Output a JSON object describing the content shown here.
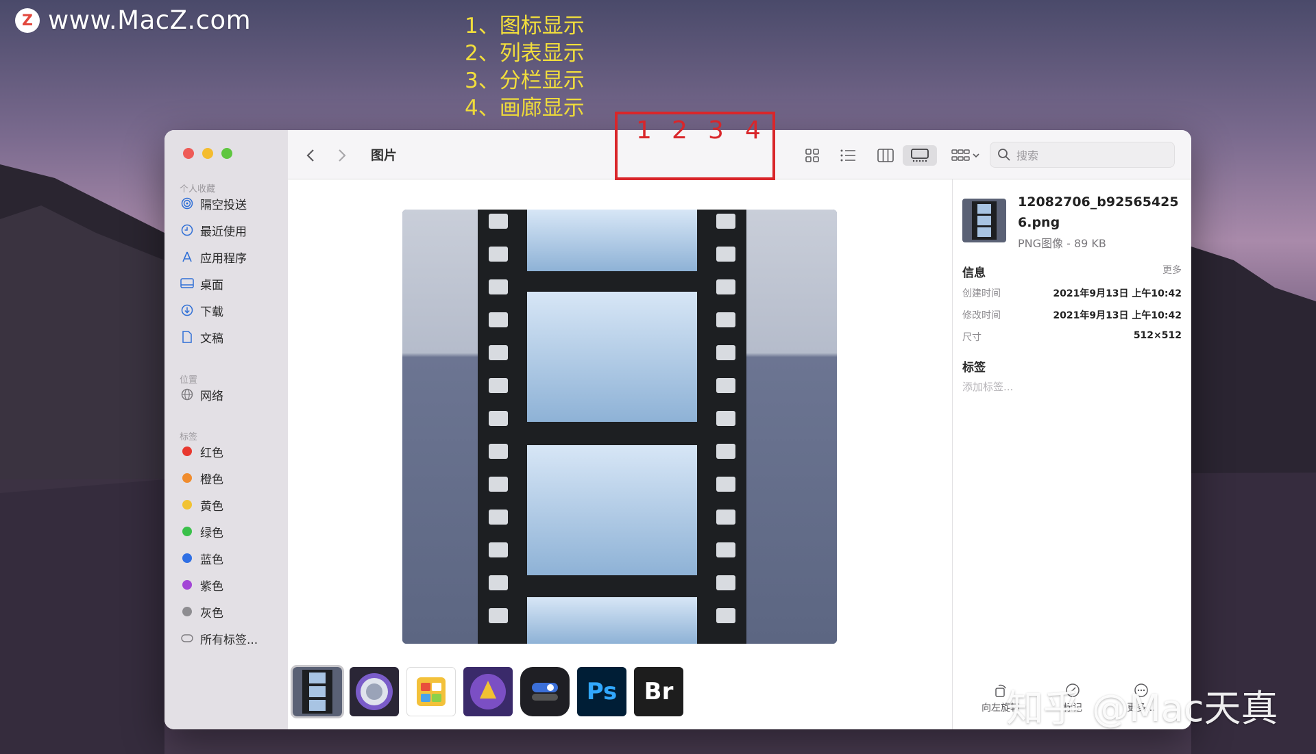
{
  "watermark": {
    "logo_letter": "Z",
    "url": "www.MacZ.com",
    "bottom": "知乎 @Mac天真"
  },
  "annotations": [
    "1、图标显示",
    "2、列表显示",
    "3、分栏显示",
    "4、画廊显示"
  ],
  "highlight_numbers": [
    "1",
    "2",
    "3",
    "4"
  ],
  "sidebar": {
    "favorites_title": "个人收藏",
    "favorites": [
      {
        "label": "隔空投送",
        "icon": "airdrop-icon"
      },
      {
        "label": "最近使用",
        "icon": "clock-icon"
      },
      {
        "label": "应用程序",
        "icon": "applications-icon"
      },
      {
        "label": "桌面",
        "icon": "desktop-icon"
      },
      {
        "label": "下载",
        "icon": "download-icon"
      },
      {
        "label": "文稿",
        "icon": "document-icon"
      }
    ],
    "locations_title": "位置",
    "locations": [
      {
        "label": "网络",
        "icon": "network-icon"
      }
    ],
    "tags_title": "标签",
    "tags": [
      {
        "label": "红色",
        "color": "#e8382f"
      },
      {
        "label": "橙色",
        "color": "#f08c2e"
      },
      {
        "label": "黄色",
        "color": "#f1c232"
      },
      {
        "label": "绿色",
        "color": "#3ac04a"
      },
      {
        "label": "蓝色",
        "color": "#2f6fe4"
      },
      {
        "label": "紫色",
        "color": "#a346d6"
      },
      {
        "label": "灰色",
        "color": "#8e8d91"
      }
    ],
    "all_tags": "所有标签..."
  },
  "toolbar": {
    "title": "图片",
    "search_placeholder": "搜索",
    "view_mode_selected": "gallery"
  },
  "gallery": {
    "thumbnails": [
      {
        "name": "film-strip",
        "label": ""
      },
      {
        "name": "orb-app",
        "label": ""
      },
      {
        "name": "budget-app",
        "label": ""
      },
      {
        "name": "game-app",
        "label": ""
      },
      {
        "name": "toggle-app",
        "label": ""
      },
      {
        "name": "photoshop",
        "label": "Ps"
      },
      {
        "name": "bridge",
        "label": "Br"
      }
    ]
  },
  "inspector": {
    "file_name": "12082706_b925654256.png",
    "file_type": "PNG图像 - 89 KB",
    "info_title": "信息",
    "more_label": "更多",
    "rows": [
      {
        "key": "创建时间",
        "value": "2021年9月13日 上午10:42"
      },
      {
        "key": "修改时间",
        "value": "2021年9月13日 上午10:42"
      },
      {
        "key": "尺寸",
        "value": "512×512"
      }
    ],
    "tags_title": "标签",
    "add_tags": "添加标签...",
    "actions": [
      "向左旋转",
      "标记",
      "更多..."
    ]
  },
  "colors": {
    "annotation": "#f2de3c",
    "highlight": "#d9262a",
    "accent": "#2f6fd6"
  }
}
